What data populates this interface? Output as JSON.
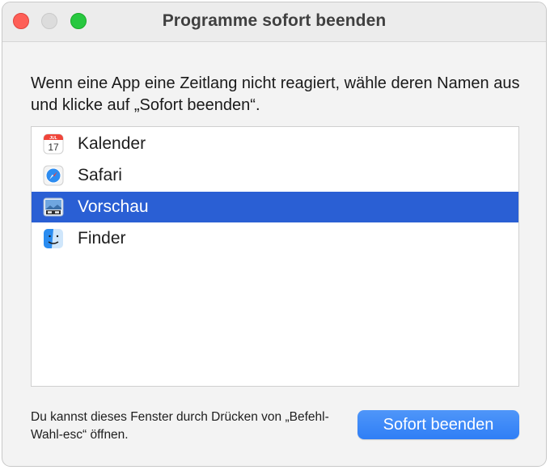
{
  "window": {
    "title": "Programme sofort beenden"
  },
  "instruction": "Wenn eine App eine Zeitlang nicht reagiert, wähle deren Namen aus und klicke auf „Sofort beenden“.",
  "apps": [
    {
      "label": "Kalender",
      "icon": "calendar-icon",
      "calendar_month": "JUL",
      "calendar_day": "17",
      "selected": false
    },
    {
      "label": "Safari",
      "icon": "safari-icon",
      "selected": false
    },
    {
      "label": "Vorschau",
      "icon": "preview-icon",
      "selected": true
    },
    {
      "label": "Finder",
      "icon": "finder-icon",
      "selected": false
    }
  ],
  "footer": {
    "hint": "Du kannst dieses Fenster durch Drücken von „Befehl-Wahl-esc“ öffnen.",
    "button_label": "Sofort beenden"
  },
  "colors": {
    "selection": "#2a5fd4",
    "button": "#3584f7",
    "close": "#fe5f57",
    "zoom": "#28c840"
  }
}
